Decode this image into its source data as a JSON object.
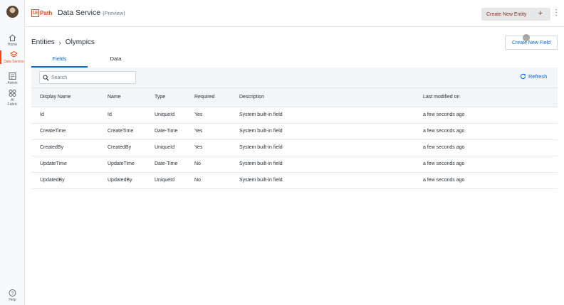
{
  "rail": {
    "items": [
      {
        "label": "Home"
      },
      {
        "label": "Data Service"
      },
      {
        "label": "Admin"
      },
      {
        "label": "AI Fabric"
      }
    ],
    "help": "Help"
  },
  "header": {
    "logo_box": "Ui",
    "logo_text": "Path",
    "title": "Data Service",
    "subtitle": "(Preview)",
    "create_entity_label": "Create New Entity",
    "create_entity_plus": "+"
  },
  "breadcrumb": {
    "root": "Entities",
    "separator": "›",
    "current": "Olympics"
  },
  "create_field_label": "Create New Field",
  "tabs": [
    {
      "label": "Fields",
      "active": true
    },
    {
      "label": "Data",
      "active": false
    }
  ],
  "search": {
    "placeholder": "Search",
    "value": ""
  },
  "refresh_label": "Refresh",
  "table": {
    "columns": [
      "Display Name",
      "Name",
      "Type",
      "Required",
      "Description",
      "Last modified on"
    ],
    "rows": [
      [
        "Id",
        "Id",
        "UniqueId",
        "Yes",
        "System built-in field",
        "a few seconds ago"
      ],
      [
        "CreateTime",
        "CreateTime",
        "Date-Time",
        "Yes",
        "System built-in field",
        "a few seconds ago"
      ],
      [
        "CreatedBy",
        "CreatedBy",
        "UniqueId",
        "Yes",
        "System built-in field",
        "a few seconds ago"
      ],
      [
        "UpdateTime",
        "UpdateTime",
        "Date-Time",
        "No",
        "System built-in field",
        "a few seconds ago"
      ],
      [
        "UpdatedBy",
        "UpdatedBy",
        "UniqueId",
        "No",
        "System built-in field",
        "a few seconds ago"
      ]
    ]
  },
  "colors": {
    "brand": "#fa4616",
    "accent": "#0067df",
    "header_bg": "#f4f5f7"
  }
}
